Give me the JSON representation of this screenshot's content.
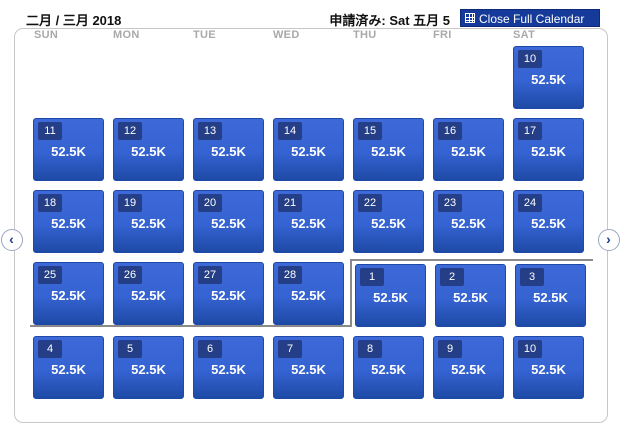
{
  "header": {
    "month_label": "二月 / 三月 2018",
    "selected_date": "申請済み: Sat 五月 5",
    "close_label": "Close Full Calendar"
  },
  "weekdays": [
    "SUN",
    "MON",
    "TUE",
    "WED",
    "THU",
    "FRI",
    "SAT"
  ],
  "weeks": [
    [
      null,
      null,
      null,
      null,
      null,
      null,
      {
        "day": "10",
        "price": "52.5K"
      }
    ],
    [
      {
        "day": "11",
        "price": "52.5K"
      },
      {
        "day": "12",
        "price": "52.5K"
      },
      {
        "day": "13",
        "price": "52.5K"
      },
      {
        "day": "14",
        "price": "52.5K"
      },
      {
        "day": "15",
        "price": "52.5K"
      },
      {
        "day": "16",
        "price": "52.5K"
      },
      {
        "day": "17",
        "price": "52.5K"
      }
    ],
    [
      {
        "day": "18",
        "price": "52.5K"
      },
      {
        "day": "19",
        "price": "52.5K"
      },
      {
        "day": "20",
        "price": "52.5K"
      },
      {
        "day": "21",
        "price": "52.5K"
      },
      {
        "day": "22",
        "price": "52.5K"
      },
      {
        "day": "23",
        "price": "52.5K"
      },
      {
        "day": "24",
        "price": "52.5K"
      }
    ],
    [
      {
        "day": "25",
        "price": "52.5K"
      },
      {
        "day": "26",
        "price": "52.5K"
      },
      {
        "day": "27",
        "price": "52.5K"
      },
      {
        "day": "28",
        "price": "52.5K"
      },
      {
        "day": "1",
        "price": "52.5K"
      },
      {
        "day": "2",
        "price": "52.5K"
      },
      {
        "day": "3",
        "price": "52.5K"
      }
    ],
    [
      {
        "day": "4",
        "price": "52.5K"
      },
      {
        "day": "5",
        "price": "52.5K"
      },
      {
        "day": "6",
        "price": "52.5K"
      },
      {
        "day": "7",
        "price": "52.5K"
      },
      {
        "day": "8",
        "price": "52.5K"
      },
      {
        "day": "9",
        "price": "52.5K"
      },
      {
        "day": "10",
        "price": "52.5K"
      }
    ]
  ],
  "nav": {
    "prev_icon": "chevron-left-icon",
    "next_icon": "chevron-right-icon",
    "prev_glyph": "‹",
    "next_glyph": "›"
  },
  "colors": {
    "accent": "#163a9a",
    "cell": "#3563d2",
    "day_badge": "#243f88"
  }
}
